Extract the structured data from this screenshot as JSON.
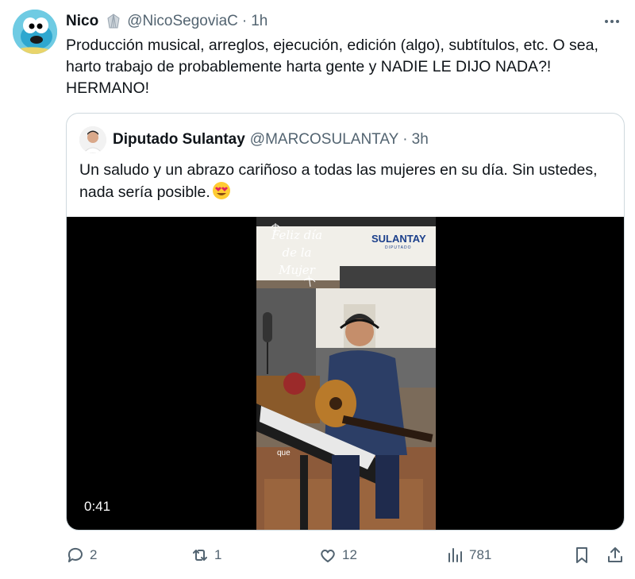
{
  "tweet": {
    "author_name": "Nico",
    "author_handle": "@NicoSegoviaC",
    "separator": "·",
    "time": "1h",
    "text": "Producción musical, arreglos, ejecución, edición (algo), subtítulos, etc. O sea, harto trabajo de probablemente harta gente y NADIE LE DIJO NADA?! HERMANO!"
  },
  "quoted": {
    "author_name": "Diputado Sulantay",
    "author_handle": "@MARCOSULANTAY",
    "separator": "·",
    "time": "3h",
    "text": "Un saludo y un abrazo cariñoso a todas las mujeres en su día. Sin ustedes, nada sería posible.",
    "emoji": "smiling-face-with-heart-eyes",
    "video": {
      "duration": "0:41",
      "overlay_title_lines": [
        "Feliz día",
        "de la",
        "Mujer"
      ],
      "brand": "SULANTAY",
      "brand_sub": "DIPUTADO",
      "caption": "que"
    }
  },
  "actions": {
    "replies": "2",
    "reposts": "1",
    "likes": "12",
    "views": "781"
  },
  "colors": {
    "text": "#0f1419",
    "secondary": "#536471",
    "border": "#cfd9de"
  }
}
